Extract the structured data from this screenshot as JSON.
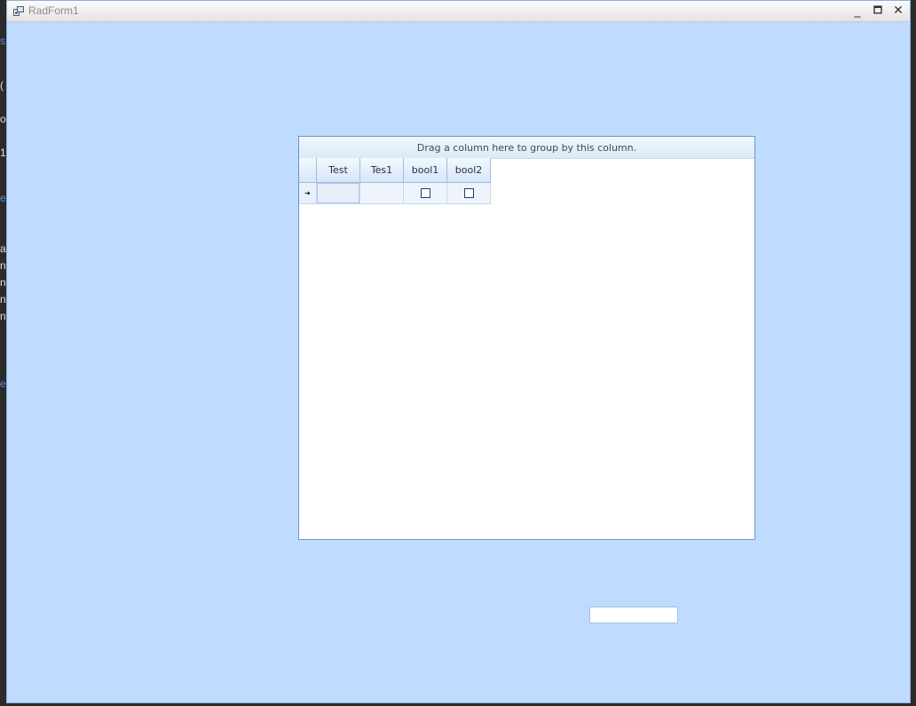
{
  "window": {
    "title": "RadForm1",
    "minimize_label": "_",
    "maximize_label": "🗖",
    "close_label": "✕"
  },
  "grid": {
    "group_panel_text": "Drag a column here to group by this column.",
    "columns": [
      "Test",
      "Tes1",
      "bool1",
      "bool2"
    ],
    "current_row_indicator": "➜",
    "rows": [
      {
        "Test": "",
        "Tes1": "",
        "bool1": false,
        "bool2": false
      }
    ]
  },
  "textbox": {
    "value": ""
  },
  "background_fragments": [
    "s",
    "(",
    "o",
    "1",
    "e",
    "a",
    "n",
    "n",
    "n",
    "n",
    "e"
  ]
}
